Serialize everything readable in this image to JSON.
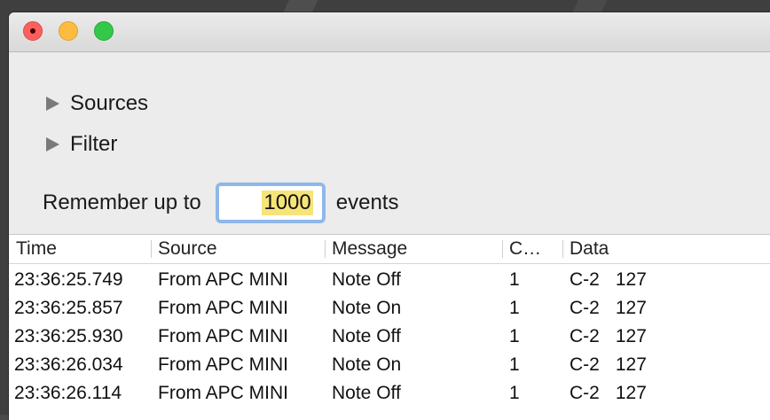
{
  "window": {
    "sections": [
      {
        "label": "Sources",
        "expanded": false
      },
      {
        "label": "Filter",
        "expanded": false
      }
    ],
    "remember": {
      "prefix": "Remember up to",
      "value": "1000",
      "suffix": "events"
    }
  },
  "table": {
    "columns": [
      "Time",
      "Source",
      "Message",
      "C…",
      "Data"
    ],
    "rows": [
      {
        "time": "23:36:25.749",
        "source": "From APC MINI",
        "message": "Note Off",
        "channel": "1",
        "note": "C-2",
        "velocity": "127"
      },
      {
        "time": "23:36:25.857",
        "source": "From APC MINI",
        "message": "Note On",
        "channel": "1",
        "note": "C-2",
        "velocity": "127"
      },
      {
        "time": "23:36:25.930",
        "source": "From APC MINI",
        "message": "Note Off",
        "channel": "1",
        "note": "C-2",
        "velocity": "127"
      },
      {
        "time": "23:36:26.034",
        "source": "From APC MINI",
        "message": "Note On",
        "channel": "1",
        "note": "C-2",
        "velocity": "127"
      },
      {
        "time": "23:36:26.114",
        "source": "From APC MINI",
        "message": "Note Off",
        "channel": "1",
        "note": "C-2",
        "velocity": "127"
      }
    ]
  },
  "colors": {
    "close": "#fc605c",
    "minimize": "#fdbc40",
    "maximize": "#34c84a",
    "focus_ring": "#8fb7ea",
    "selection": "#f6e47a"
  }
}
